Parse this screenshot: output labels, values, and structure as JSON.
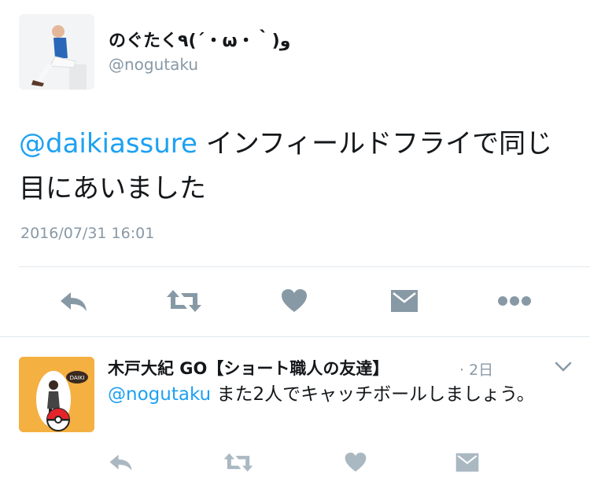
{
  "tweet": {
    "display_name": "のぐたく٩(´・ω・｀)و",
    "handle": "@nogutaku",
    "mention": "@daikiassure",
    "text": " インフィールドフライで同じ目にあいました",
    "timestamp": "2016/07/31 16:01",
    "actions": [
      "reply-icon",
      "retweet-icon",
      "like-icon",
      "message-icon",
      "more-icon"
    ]
  },
  "reply": {
    "display_name": "木戸大紀 GO【ショート職人の友達】",
    "time": "· 2日",
    "mention": "@nogutaku",
    "text": " また2人でキャッチボールしましょう。",
    "avatar_badge": "DAIKI",
    "actions": [
      "reply-icon",
      "retweet-icon",
      "like-icon",
      "message-icon"
    ]
  },
  "colors": {
    "link": "#1da1f2",
    "secondary_text": "#8899a6",
    "icon": "#8899a6",
    "icon_light": "#aab8c2",
    "divider": "#e1e8ed",
    "reply_avatar_bg": "#f5b042"
  }
}
